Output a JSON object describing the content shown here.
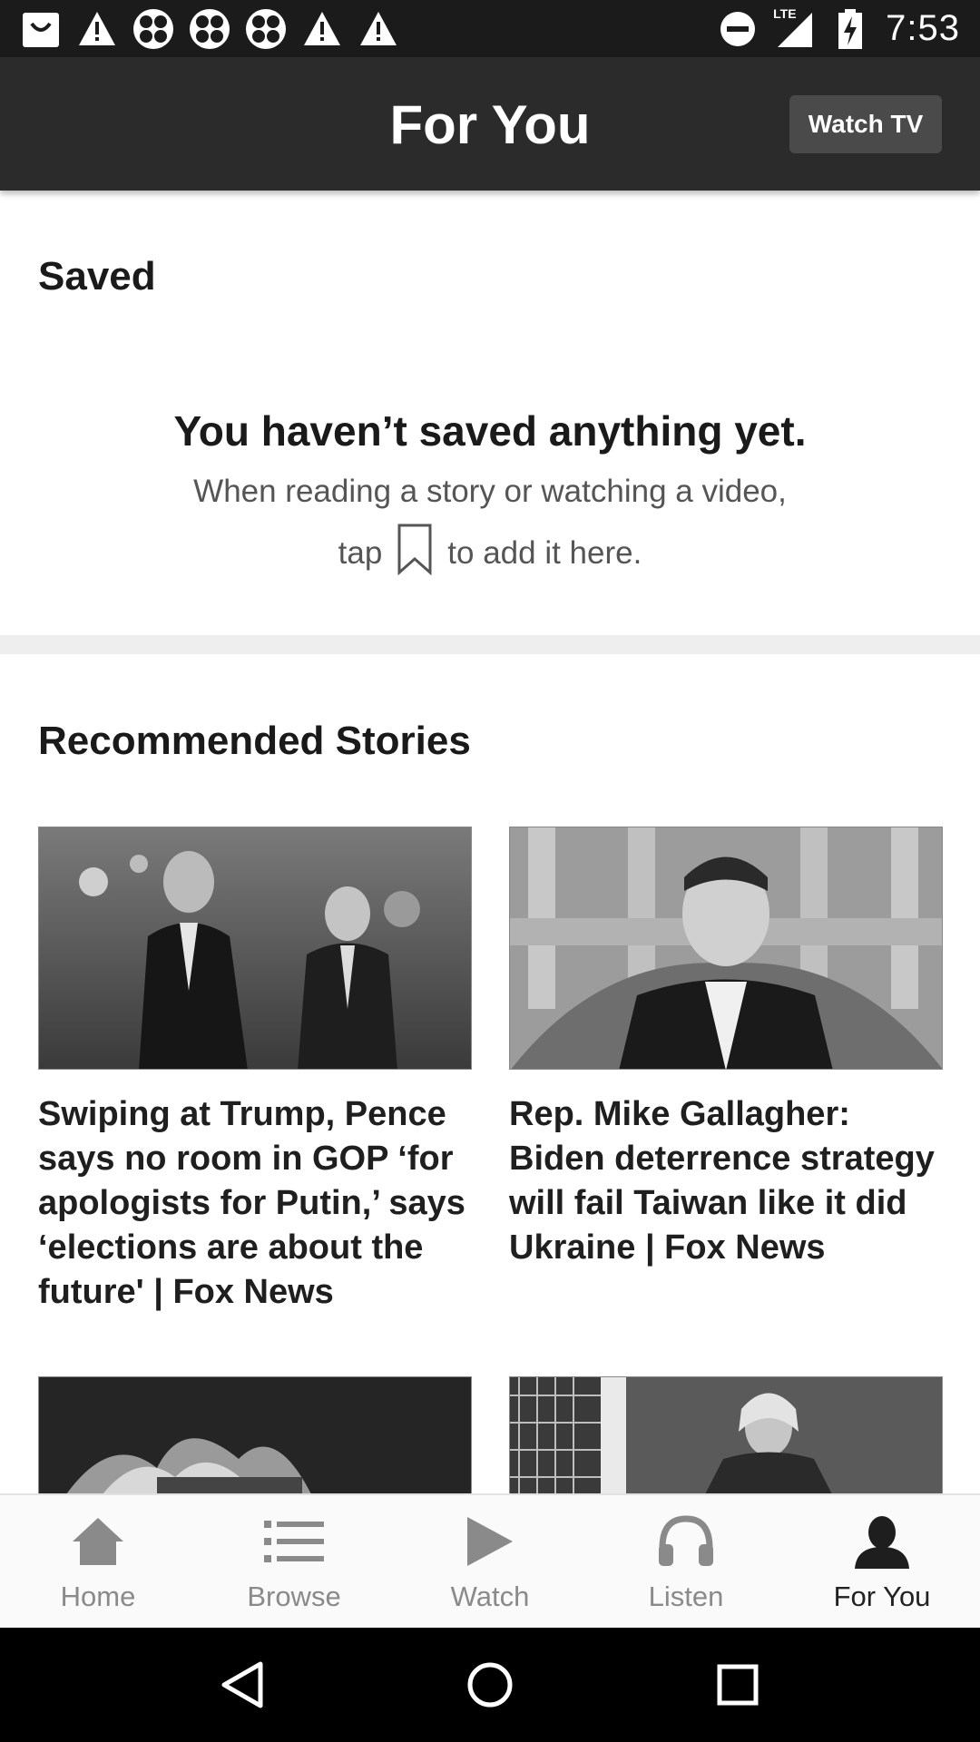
{
  "status_bar": {
    "time": "7:53",
    "network": "LTE",
    "left_icons": [
      "shopping-bag-icon",
      "warning-icon",
      "clover-icon",
      "clover-icon",
      "clover-icon",
      "warning-icon",
      "warning-icon"
    ]
  },
  "app_bar": {
    "title": "For You",
    "watch_tv_label": "Watch TV"
  },
  "saved": {
    "heading": "Saved",
    "empty_title": "You haven’t saved anything yet.",
    "empty_line1": "When reading a story or watching a video,",
    "empty_line2_before": "tap",
    "empty_line2_after": "to add it here."
  },
  "recommended": {
    "heading": "Recommended Stories",
    "stories": [
      {
        "title": "Swiping at Trump, Pence says no room in GOP ‘for apologists for Putin,’ says ‘elections are about the future' | Fox News"
      },
      {
        "title": "Rep. Mike Gallagher: Biden deterrence strategy will fail Taiwan like it did Ukraine | Fox News"
      },
      {
        "title": ""
      },
      {
        "title": ""
      }
    ]
  },
  "bottom_nav": {
    "items": [
      {
        "label": "Home",
        "icon": "home-icon"
      },
      {
        "label": "Browse",
        "icon": "list-icon"
      },
      {
        "label": "Watch",
        "icon": "play-icon"
      },
      {
        "label": "Listen",
        "icon": "headphones-icon"
      },
      {
        "label": "For You",
        "icon": "person-icon"
      }
    ],
    "active": "For You"
  },
  "colors": {
    "status_bar": "#1b1b1b",
    "app_bar": "#2b2b2b",
    "watch_tv_button": "#4a4a4a",
    "divider": "#eeeeee",
    "nav_inactive": "#8a8a8a",
    "nav_active": "#222222"
  }
}
